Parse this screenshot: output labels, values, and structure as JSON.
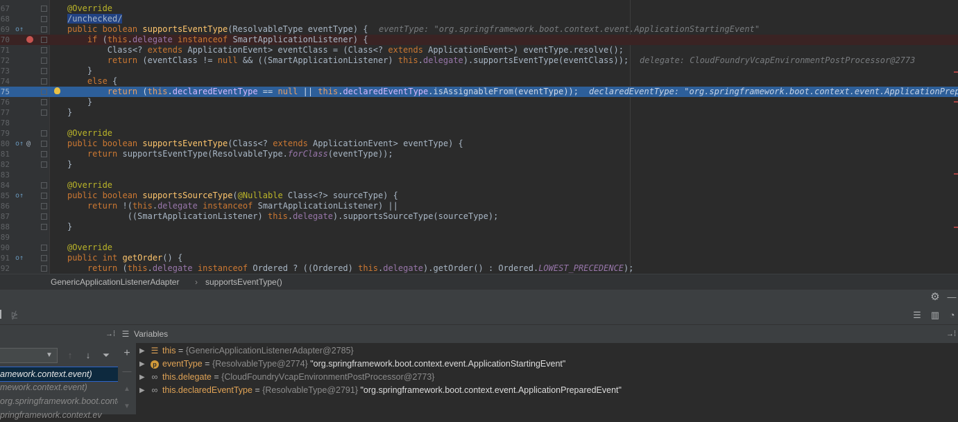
{
  "editor": {
    "lines": [
      {
        "n": "67",
        "segments": [
          [
            "an",
            "@Override"
          ]
        ]
      },
      {
        "n": "68",
        "segments": [
          [
            "sel",
            "/unchecked/"
          ]
        ]
      },
      {
        "n": "69",
        "segments": [
          [
            "k",
            "public "
          ],
          [
            "k",
            "boolean "
          ],
          [
            "fn",
            "supportsEventType"
          ],
          [
            "t",
            "(ResolvableType eventType) {"
          ]
        ],
        "inline": "eventType: \"org.springframework.boot.context.event.ApplicationStartingEvent\""
      },
      {
        "n": "70",
        "segments": [
          [
            "t",
            "    "
          ],
          [
            "k",
            "if "
          ],
          [
            "t",
            "("
          ],
          [
            "k",
            "this"
          ],
          [
            "t",
            "."
          ],
          [
            "fl",
            "delegate"
          ],
          [
            "t",
            " "
          ],
          [
            "k",
            "instanceof "
          ],
          [
            "t",
            "SmartApplicationListener) {"
          ]
        ]
      },
      {
        "n": "71",
        "segments": [
          [
            "t",
            "        Class<? "
          ],
          [
            "k",
            "extends "
          ],
          [
            "t",
            "ApplicationEvent> eventClass = (Class<? "
          ],
          [
            "k",
            "extends "
          ],
          [
            "t",
            "ApplicationEvent>) eventType.resolve();"
          ]
        ]
      },
      {
        "n": "72",
        "segments": [
          [
            "t",
            "        "
          ],
          [
            "k",
            "return "
          ],
          [
            "t",
            "(eventClass != "
          ],
          [
            "k",
            "null "
          ],
          [
            "t",
            "&& ((SmartApplicationListener) "
          ],
          [
            "k",
            "this"
          ],
          [
            "t",
            "."
          ],
          [
            "fl",
            "delegate"
          ],
          [
            "t",
            ").supportsEventType(eventClass));"
          ]
        ],
        "inline": "delegate: CloudFoundryVcapEnvironmentPostProcessor@2773"
      },
      {
        "n": "73",
        "segments": [
          [
            "t",
            "    }"
          ]
        ]
      },
      {
        "n": "74",
        "segments": [
          [
            "t",
            "    "
          ],
          [
            "k",
            "else "
          ],
          [
            "t",
            "{"
          ]
        ]
      },
      {
        "n": "75",
        "segments": [
          [
            "t",
            "        "
          ],
          [
            "k",
            "return "
          ],
          [
            "t",
            "("
          ],
          [
            "k",
            "this"
          ],
          [
            "t",
            "."
          ],
          [
            "fl",
            "declaredEventType"
          ],
          [
            "t",
            " == "
          ],
          [
            "k",
            "null "
          ],
          [
            "t",
            "|| "
          ],
          [
            "k",
            "this"
          ],
          [
            "t",
            "."
          ],
          [
            "fl",
            "declaredEventType"
          ],
          [
            "t",
            ".isAssignableFrom(eventType));"
          ]
        ],
        "inline": "declaredEventType: \"org.springframework.boot.context.event.ApplicationPreparedEvent\""
      },
      {
        "n": "76",
        "segments": [
          [
            "t",
            "    }"
          ]
        ]
      },
      {
        "n": "77",
        "segments": [
          [
            "t",
            "}"
          ]
        ]
      },
      {
        "n": "78",
        "segments": []
      },
      {
        "n": "79",
        "segments": [
          [
            "an",
            "@Override"
          ]
        ]
      },
      {
        "n": "80",
        "segments": [
          [
            "k",
            "public "
          ],
          [
            "k",
            "boolean "
          ],
          [
            "fn",
            "supportsEventType"
          ],
          [
            "t",
            "(Class<? "
          ],
          [
            "k",
            "extends "
          ],
          [
            "t",
            "ApplicationEvent> eventType) {"
          ]
        ]
      },
      {
        "n": "81",
        "segments": [
          [
            "t",
            "    "
          ],
          [
            "k",
            "return "
          ],
          [
            "t",
            "supportsEventType(ResolvableType."
          ],
          [
            "it",
            "forClass"
          ],
          [
            "t",
            "(eventType));"
          ]
        ]
      },
      {
        "n": "82",
        "segments": [
          [
            "t",
            "}"
          ]
        ]
      },
      {
        "n": "83",
        "segments": []
      },
      {
        "n": "84",
        "segments": [
          [
            "an",
            "@Override"
          ]
        ]
      },
      {
        "n": "85",
        "segments": [
          [
            "k",
            "public "
          ],
          [
            "k",
            "boolean "
          ],
          [
            "fn",
            "supportsSourceType"
          ],
          [
            "t",
            "("
          ],
          [
            "an",
            "@Nullable "
          ],
          [
            "t",
            "Class<?> sourceType) {"
          ]
        ]
      },
      {
        "n": "86",
        "segments": [
          [
            "t",
            "    "
          ],
          [
            "k",
            "return "
          ],
          [
            "t",
            "!("
          ],
          [
            "k",
            "this"
          ],
          [
            "t",
            "."
          ],
          [
            "fl",
            "delegate"
          ],
          [
            "t",
            " "
          ],
          [
            "k",
            "instanceof "
          ],
          [
            "t",
            "SmartApplicationListener) ||"
          ]
        ]
      },
      {
        "n": "87",
        "segments": [
          [
            "t",
            "            ((SmartApplicationListener) "
          ],
          [
            "k",
            "this"
          ],
          [
            "t",
            "."
          ],
          [
            "fl",
            "delegate"
          ],
          [
            "t",
            ").supportsSourceType(sourceType);"
          ]
        ]
      },
      {
        "n": "88",
        "segments": [
          [
            "t",
            "}"
          ]
        ]
      },
      {
        "n": "89",
        "segments": []
      },
      {
        "n": "90",
        "segments": [
          [
            "an",
            "@Override"
          ]
        ]
      },
      {
        "n": "91",
        "segments": [
          [
            "k",
            "public "
          ],
          [
            "k",
            "int "
          ],
          [
            "fn",
            "getOrder"
          ],
          [
            "t",
            "() {"
          ]
        ]
      },
      {
        "n": "92",
        "segments": [
          [
            "t",
            "    "
          ],
          [
            "k",
            "return "
          ],
          [
            "t",
            "("
          ],
          [
            "k",
            "this"
          ],
          [
            "t",
            "."
          ],
          [
            "fl",
            "delegate"
          ],
          [
            "t",
            " "
          ],
          [
            "k",
            "instanceof "
          ],
          [
            "t",
            "Ordered ? ((Ordered) "
          ],
          [
            "k",
            "this"
          ],
          [
            "t",
            "."
          ],
          [
            "fl",
            "delegate"
          ],
          [
            "t",
            ").getOrder() : Ordered."
          ],
          [
            "it",
            "LOWEST_PRECEDENCE"
          ],
          [
            "t",
            ");"
          ]
        ]
      }
    ],
    "breakpoint_line": "70",
    "exec_line": "75"
  },
  "breadcrumb": {
    "class_name": "GenericApplicationListenerAdapter",
    "separator": "›",
    "method_name": "supportsEventType()"
  },
  "debugger": {
    "variables_title": "Variables",
    "frames": [
      {
        "label": "amework.context.event)",
        "state": "active"
      },
      {
        "label": "mework.context.event)",
        "state": "dim"
      },
      {
        "label": "org.springframework.boot.contex",
        "state": "dim"
      },
      {
        "label": "pringframework.context.ev",
        "state": "dim"
      }
    ],
    "variables": [
      {
        "icon": "field-icon",
        "name": "this",
        "ref": "{GenericApplicationListenerAdapter@2785}",
        "value": ""
      },
      {
        "icon": "param-icon",
        "name": "eventType",
        "ref": "{ResolvableType@2774}",
        "value": "\"org.springframework.boot.context.event.ApplicationStartingEvent\""
      },
      {
        "icon": "watch-icon",
        "name": "this.delegate",
        "ref": "{CloudFoundryVcapEnvironmentPostProcessor@2773}",
        "value": ""
      },
      {
        "icon": "watch-icon",
        "name": "this.declaredEventType",
        "ref": "{ResolvableType@2791}",
        "value": "\"org.springframework.boot.context.event.ApplicationPreparedEvent\""
      }
    ]
  },
  "colors": {
    "editor_bg": "#2b2b2b",
    "exec_line": "#2d5f9a",
    "breakpoint_line": "#3a2323",
    "keyword": "#cc7832",
    "annotation": "#bbb529",
    "method": "#ffc66d",
    "field": "#9876aa"
  }
}
